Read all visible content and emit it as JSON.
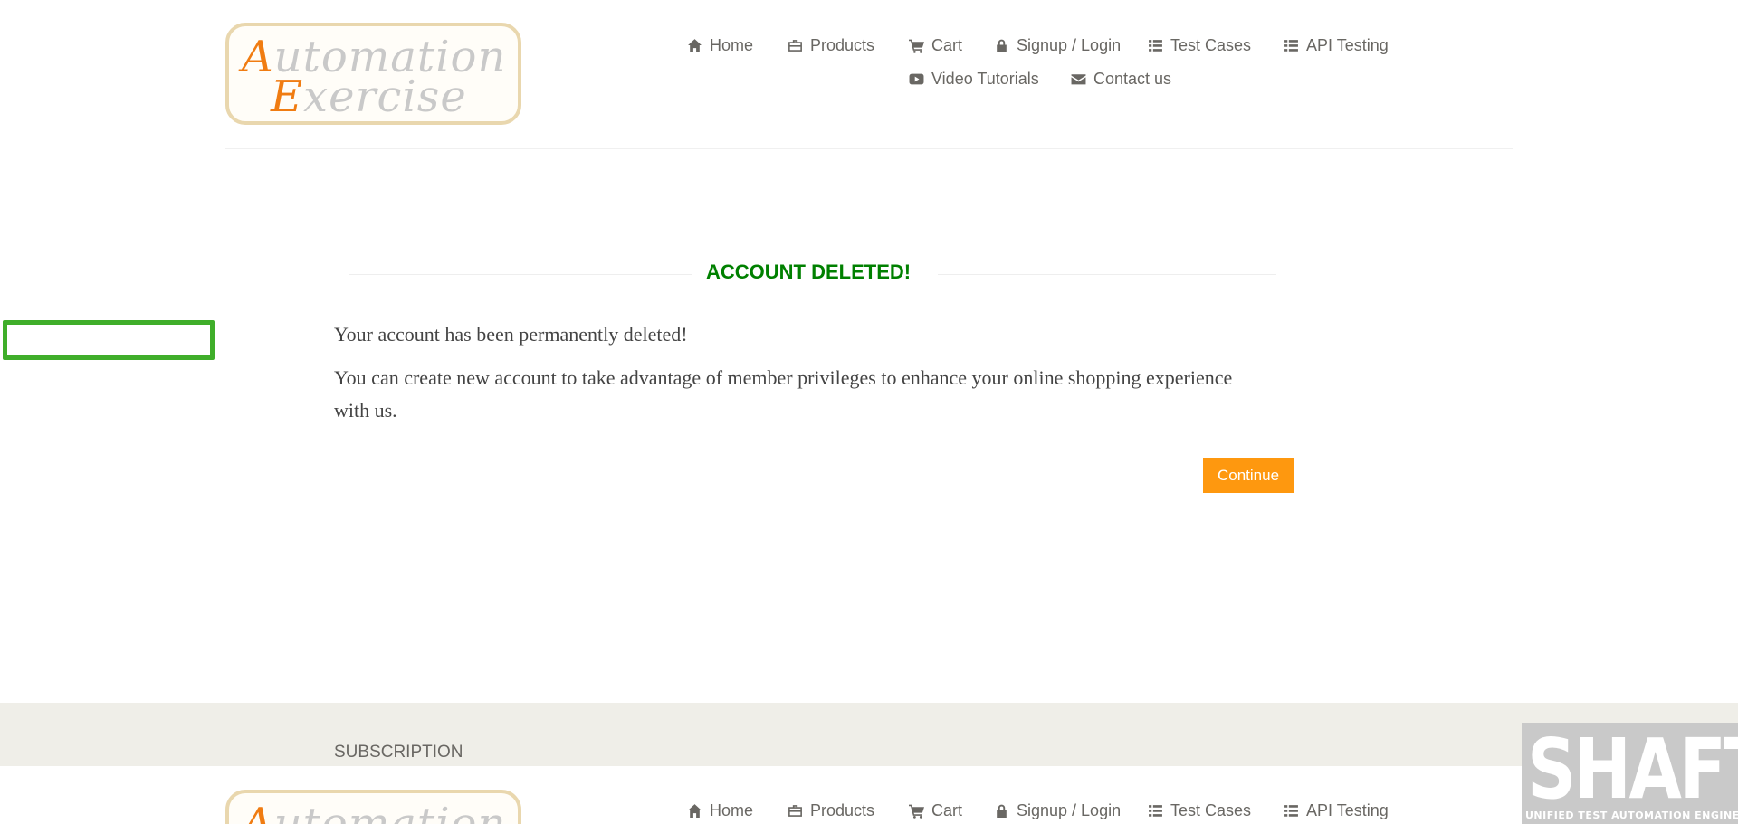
{
  "logo": {
    "line1_cap": "A",
    "line1_rest": "utomation",
    "line2_cap": "E",
    "line2_rest": "xercise"
  },
  "nav": {
    "items": [
      {
        "label": "Home",
        "icon": "home-icon"
      },
      {
        "label": "Products",
        "icon": "briefcase-icon"
      },
      {
        "label": "Cart",
        "icon": "cart-icon"
      },
      {
        "label": "Signup / Login",
        "icon": "lock-icon"
      },
      {
        "label": "Test Cases",
        "icon": "list-icon"
      },
      {
        "label": "API Testing",
        "icon": "list-icon"
      },
      {
        "label": "Video Tutorials",
        "icon": "youtube-play-icon"
      },
      {
        "label": "Contact us",
        "icon": "envelope-icon"
      }
    ]
  },
  "main": {
    "title": "ACCOUNT DELETED!",
    "message1": "Your account has been permanently deleted!",
    "message2": "You can create new account to take advantage of member privileges to enhance your online shopping experience with us.",
    "continue_label": "Continue"
  },
  "footer": {
    "subscription_label": "SUBSCRIPTION"
  },
  "watermark": {
    "big": "SHAFT",
    "small": "UNIFIED TEST AUTOMATION ENGINE"
  },
  "colors": {
    "title_green": "#008000",
    "button_orange": "#fe980f",
    "highlight_green": "#3fae2a",
    "footer_bg": "#efeee8"
  }
}
